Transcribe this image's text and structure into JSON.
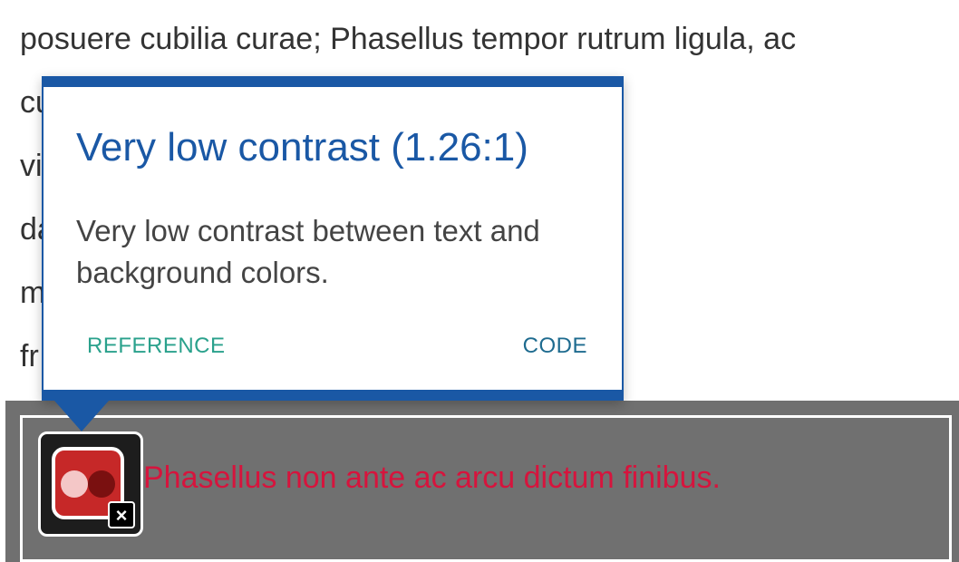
{
  "page": {
    "paragraph_lines": [
      "posuere cubilia curae; Phasellus tempor rutrum ligula, ac",
      "cu                                                                    nec pulvinar ipsum",
      "vi                                                                    unt mi ac rhoncus",
      "da                                                                   ous egestas. Sed at",
      "m                                                                     cus. Duis mollis",
      "fr                                                                     iet ullamcorper."
    ],
    "flagged_text": "Phasellus non ante ac arcu dictum finibus."
  },
  "popup": {
    "title": "Very low contrast (1.26:1)",
    "body": "Very low contrast between text and background colors.",
    "reference_label": "REFERENCE",
    "code_label": "CODE"
  },
  "badge": {
    "icon": "contrast-error-icon",
    "close_icon": "close-icon",
    "close_glyph": "×"
  },
  "colors": {
    "accent": "#1a58a5",
    "reference_link": "#2aa18c",
    "code_link": "#1e6b8f",
    "flagged_text": "#d6143d",
    "highlight_background": "#707070",
    "badge_red": "#c62828"
  }
}
